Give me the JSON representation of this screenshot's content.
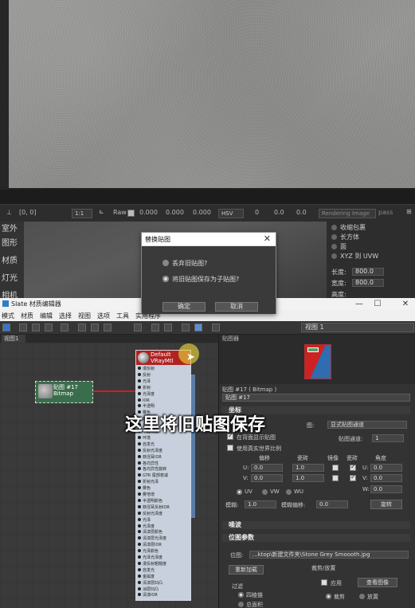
{
  "render_toolbar": {
    "coords": "[0, 0]",
    "zoom": "1:1",
    "raw_label": "Raw",
    "values": [
      "0.000",
      "0.000",
      "0.000"
    ],
    "color_mode": "HSV",
    "hsv_values": [
      "0",
      "0.0",
      "0.0"
    ],
    "rendering_mode": "Rendering Image",
    "pass_label": "pass"
  },
  "left_panel": {
    "labels": [
      "室外",
      "图形",
      "材质",
      "灯光",
      "相机"
    ]
  },
  "right_panel": {
    "options": [
      "收缩包裹",
      "长方体",
      "面",
      "XYZ 到 UVW"
    ],
    "length_label": "长度:",
    "length_value": "800.0",
    "width_label": "宽度:",
    "width_value": "800.0",
    "height_label": "高度:"
  },
  "dialog": {
    "title": "替换贴图",
    "option_discard": "丢弃旧贴图?",
    "option_keep": "将旧贴图保存为子贴图?",
    "ok_label": "确定",
    "cancel_label": "取消"
  },
  "slate": {
    "title": "Slate 材质编辑器",
    "menu": [
      "模式",
      "材质",
      "编辑",
      "选择",
      "视图",
      "选项",
      "工具",
      "实用程序"
    ],
    "view_label": "视图 1",
    "view_tab": "视图1"
  },
  "nodes": {
    "bitmap_title": "贴图 #17",
    "bitmap_sub": "Bitmap",
    "material_title": "Default",
    "material_sub": "VRayMtl",
    "slots": [
      "漫反射",
      "反射",
      "光泽",
      "折射",
      "光泽度",
      "IOR",
      "半透明",
      "雾色",
      "凹凸",
      "置换",
      "不透明度",
      "环境",
      "自发光",
      "反射光泽度",
      "菲涅耳IOR",
      "各向异性",
      "各向异性旋转",
      "GTR 尾部衰减",
      "折射光泽",
      "雾色",
      "雾倍增",
      "半透明颜色",
      "菲涅耳反射IOR",
      "反射光泽度",
      "光泽",
      "光泽度",
      "清漆层颜色",
      "清漆层光泽度",
      "清漆层IOR",
      "光泽颜色",
      "光泽光泽度",
      "漫反射粗糙度",
      "自发光",
      "金属度",
      "清漆层凹凸",
      "涂层凹凸",
      "清漆IOR"
    ]
  },
  "caption": "这里将旧贴图保存",
  "browser_title": "贴图器",
  "params": {
    "header_label": "贴图 #17 ( Bitmap )",
    "map_name": "贴图 #17",
    "coords_section": "坐标",
    "map_type_label": "图:",
    "map_type_value": "显式贴图通道",
    "show_in_viewport": "在背面显示贴图",
    "map_channel_label": "贴图通道:",
    "map_channel_value": "1",
    "real_world": "使用真实世界比例",
    "col_offset": "偏移",
    "col_tiling": "瓷砖",
    "col_mirror": "镜像",
    "col_tile": "瓷砖",
    "col_angle": "角度",
    "u_label": "U:",
    "u_offset": "0.0",
    "u_tiling": "1.0",
    "v_label": "V:",
    "v_offset": "0.0",
    "v_tiling": "1.0",
    "angle_u": "0.0",
    "angle_v": "0.0",
    "angle_w": "0.0",
    "w_label": "W:",
    "uv_options": [
      "UV",
      "VW",
      "WU"
    ],
    "blur_label": "模糊:",
    "blur_value": "1.0",
    "blur_offset_label": "模糊偏移:",
    "blur_offset_value": "0.0",
    "rotate_label": "旋转",
    "noise_section": "噪波",
    "bitmap_params_section": "位图参数",
    "bitmap_path_label": "位图:",
    "bitmap_path": "...ktop\\新建文件夹\\Stone Grey Smoooth.jpg",
    "reload_label": "重新加载",
    "crop_label": "裁剪/放置",
    "apply_label": "应用",
    "view_image_label": "查看图像",
    "filter_label": "过滤",
    "filter_pyramid": "四棱锥",
    "filter_summed": "总面积",
    "crop_option": "裁剪",
    "place_option": "放置"
  }
}
